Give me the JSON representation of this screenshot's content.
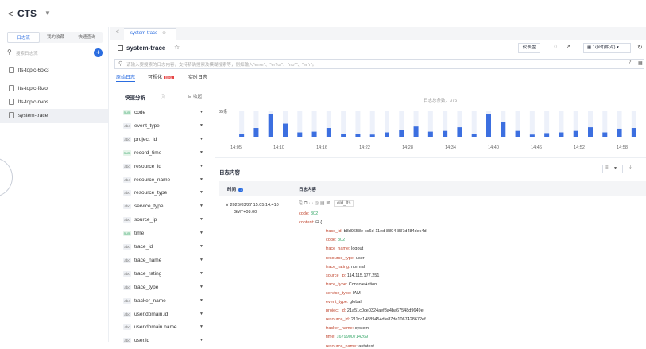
{
  "app": {
    "back": "<",
    "title": "CTS",
    "caret": "▼"
  },
  "left": {
    "tabs": [
      "日志流",
      "我的收藏",
      "快速查询"
    ],
    "search_placeholder": "搜索日志流",
    "add": "+",
    "items": [
      "lts-topic-6ox3",
      "lts-topic-f8zo",
      "lts-topic-nvos",
      "system-trace"
    ]
  },
  "tabbar": {
    "back": "<",
    "tab_label": "system-trace",
    "close": "⊗"
  },
  "header": {
    "title": "system-trace",
    "star": "☆",
    "dashboard": "仪表盘",
    "time_range": "1小时(相对) ▾"
  },
  "query": {
    "placeholder": "请输入要搜索的日志内容，支持精确搜索及模糊搜索等，例如输入\"error\"、\"er?or\"、\"rro*\"、\"er*r\"。"
  },
  "subtabs": [
    {
      "label": "原始日志",
      "active": true
    },
    {
      "label": "可视化",
      "beta": "Beta",
      "active": false
    },
    {
      "label": "实时日志",
      "active": false
    }
  ],
  "fields_panel": {
    "title": "快速分析",
    "help": "ⓘ",
    "collapse": "收起"
  },
  "fields": [
    {
      "type": "num",
      "name": "code"
    },
    {
      "type": "abc",
      "name": "event_type"
    },
    {
      "type": "abc",
      "name": "project_id"
    },
    {
      "type": "num",
      "name": "record_time"
    },
    {
      "type": "abc",
      "name": "resource_id"
    },
    {
      "type": "abc",
      "name": "resource_name"
    },
    {
      "type": "abc",
      "name": "resource_type"
    },
    {
      "type": "abc",
      "name": "service_type"
    },
    {
      "type": "abc",
      "name": "source_ip"
    },
    {
      "type": "num",
      "name": "time"
    },
    {
      "type": "abc",
      "name": "trace_id"
    },
    {
      "type": "abc",
      "name": "trace_name"
    },
    {
      "type": "abc",
      "name": "trace_rating"
    },
    {
      "type": "abc",
      "name": "trace_type"
    },
    {
      "type": "abc",
      "name": "tracker_name"
    },
    {
      "type": "abc",
      "name": "user.domain.id"
    },
    {
      "type": "abc",
      "name": "user.domain.name"
    },
    {
      "type": "abc",
      "name": "user.id"
    }
  ],
  "chart_data": {
    "type": "bar",
    "title": "日志总条数：375",
    "y_tick": "35条",
    "x_ticks": [
      "14:05",
      "14:10",
      "14:16",
      "14:22",
      "14:28",
      "14:34",
      "14:40",
      "14:46",
      "14:52",
      "14:58"
    ],
    "values": [
      4,
      12,
      31,
      18,
      6,
      7,
      12,
      4,
      4,
      3,
      6,
      9,
      14,
      7,
      8,
      13,
      4,
      31,
      20,
      8,
      3,
      5,
      6,
      8,
      13,
      6,
      11,
      12
    ],
    "ylim": [
      0,
      35
    ],
    "bar_color": "#3c6fe0",
    "stripe_color": "#edf1fa"
  },
  "content": {
    "title": "日志内容",
    "col_time": "时间",
    "col_content": "日志内容",
    "row_time": [
      "2023/03/27 15:05:14.410",
      "GMT+08:00"
    ],
    "tag": "old_lts",
    "lines": [
      {
        "k": "code",
        "v": "302",
        "num": true,
        "indent": 0
      },
      {
        "k": "content",
        "v": "⊟ {",
        "num": false,
        "indent": 0
      },
      {
        "k": "trace_id",
        "v": "b8d9658e-cc6d-11ed-8894-837d484dec4d",
        "num": false,
        "indent": 1
      },
      {
        "k": "code",
        "v": "302",
        "num": true,
        "indent": 1
      },
      {
        "k": "trace_name",
        "v": "logout",
        "num": false,
        "indent": 1
      },
      {
        "k": "resource_type",
        "v": "user",
        "num": false,
        "indent": 1
      },
      {
        "k": "trace_rating",
        "v": "normal",
        "num": false,
        "indent": 1
      },
      {
        "k": "source_ip",
        "v": "114.115.177.251",
        "num": false,
        "indent": 1
      },
      {
        "k": "trace_type",
        "v": "ConsoleAction",
        "num": false,
        "indent": 1
      },
      {
        "k": "service_type",
        "v": "IAM",
        "num": false,
        "indent": 1
      },
      {
        "k": "event_type",
        "v": "global",
        "num": false,
        "indent": 1
      },
      {
        "k": "project_id",
        "v": "21a51c0ce0324aef8a4ba67548d9649e",
        "num": false,
        "indent": 1
      },
      {
        "k": "resource_id",
        "v": "211cc14889454dfe87de1067428672ef",
        "num": false,
        "indent": 1
      },
      {
        "k": "tracker_name",
        "v": "system",
        "num": false,
        "indent": 1
      },
      {
        "k": "time",
        "v": "1679900714269",
        "num": true,
        "indent": 1
      },
      {
        "k": "resource_name",
        "v": "autotest",
        "num": false,
        "indent": 1
      }
    ]
  }
}
